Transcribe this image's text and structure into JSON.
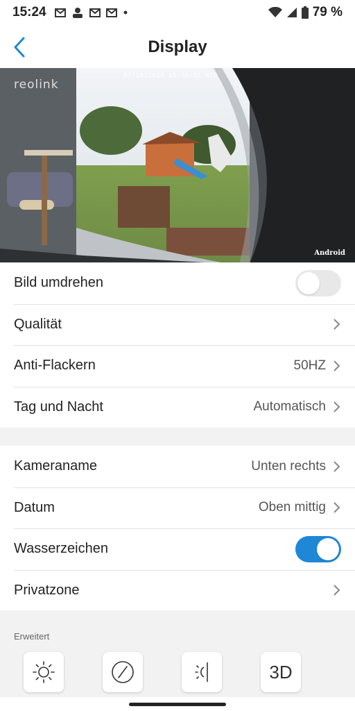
{
  "status": {
    "time": "15:24",
    "battery": "79 %",
    "icons": [
      "gmail-icon",
      "user-icon",
      "gmail-icon",
      "gmail-icon",
      "dot-icon",
      "wifi-icon",
      "signal-icon",
      "battery-icon"
    ]
  },
  "header": {
    "title": "Display",
    "back_icon": "chevron-left-icon"
  },
  "preview": {
    "timestamp": "07/18/2020 15:24:02 WED",
    "logo": "reolink",
    "channel": "Android"
  },
  "settings_a": [
    {
      "label": "Bild umdrehen",
      "type": "toggle",
      "state": "off"
    },
    {
      "label": "Qualität",
      "type": "link"
    },
    {
      "label": "Anti-Flackern",
      "value": "50HZ",
      "type": "link"
    },
    {
      "label": "Tag und Nacht",
      "value": "Automatisch",
      "type": "link"
    }
  ],
  "settings_b": [
    {
      "label": "Kameraname",
      "value": "Unten rechts",
      "type": "link"
    },
    {
      "label": "Datum",
      "value": "Oben mittig",
      "type": "link"
    },
    {
      "label": "Wasserzeichen",
      "type": "toggle",
      "state": "on"
    },
    {
      "label": "Privatzone",
      "type": "link"
    }
  ],
  "advanced": {
    "section_label": "Erweitert",
    "tools": [
      {
        "icon": "brightness-icon"
      },
      {
        "icon": "contrast-icon"
      },
      {
        "icon": "sharpness-icon"
      },
      {
        "icon": "3d-noise-icon",
        "text": "3D"
      }
    ]
  },
  "colors": {
    "accent": "#1e88d6",
    "toggle_off": "#e8e8e8",
    "divider": "#e2e2e2",
    "section_bg": "#f2f2f2"
  }
}
